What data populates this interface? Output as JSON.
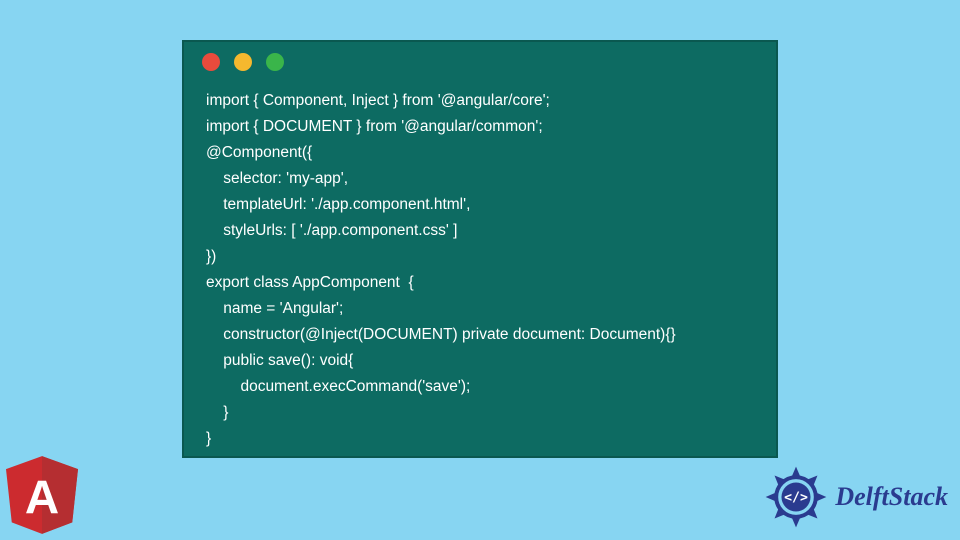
{
  "window": {
    "dots": [
      "red",
      "yellow",
      "green"
    ]
  },
  "code": {
    "lines": [
      "import { Component, Inject } from '@angular/core';",
      "import { DOCUMENT } from '@angular/common';",
      "@Component({",
      "    selector: 'my-app',",
      "    templateUrl: './app.component.html',",
      "    styleUrls: [ './app.component.css' ]",
      "})",
      "export class AppComponent  {",
      "    name = 'Angular';",
      "    constructor(@Inject(DOCUMENT) private document: Document){}",
      "    public save(): void{",
      "        document.execCommand('save');",
      "    }",
      "}"
    ]
  },
  "logos": {
    "angular_letter": "A",
    "delft_text": "DelftStack",
    "delft_glyph": "</>"
  },
  "colors": {
    "bg": "#87d5f2",
    "window": "#0d6b62",
    "angular": "#cc2b2f",
    "delft": "#2a3b8f"
  }
}
